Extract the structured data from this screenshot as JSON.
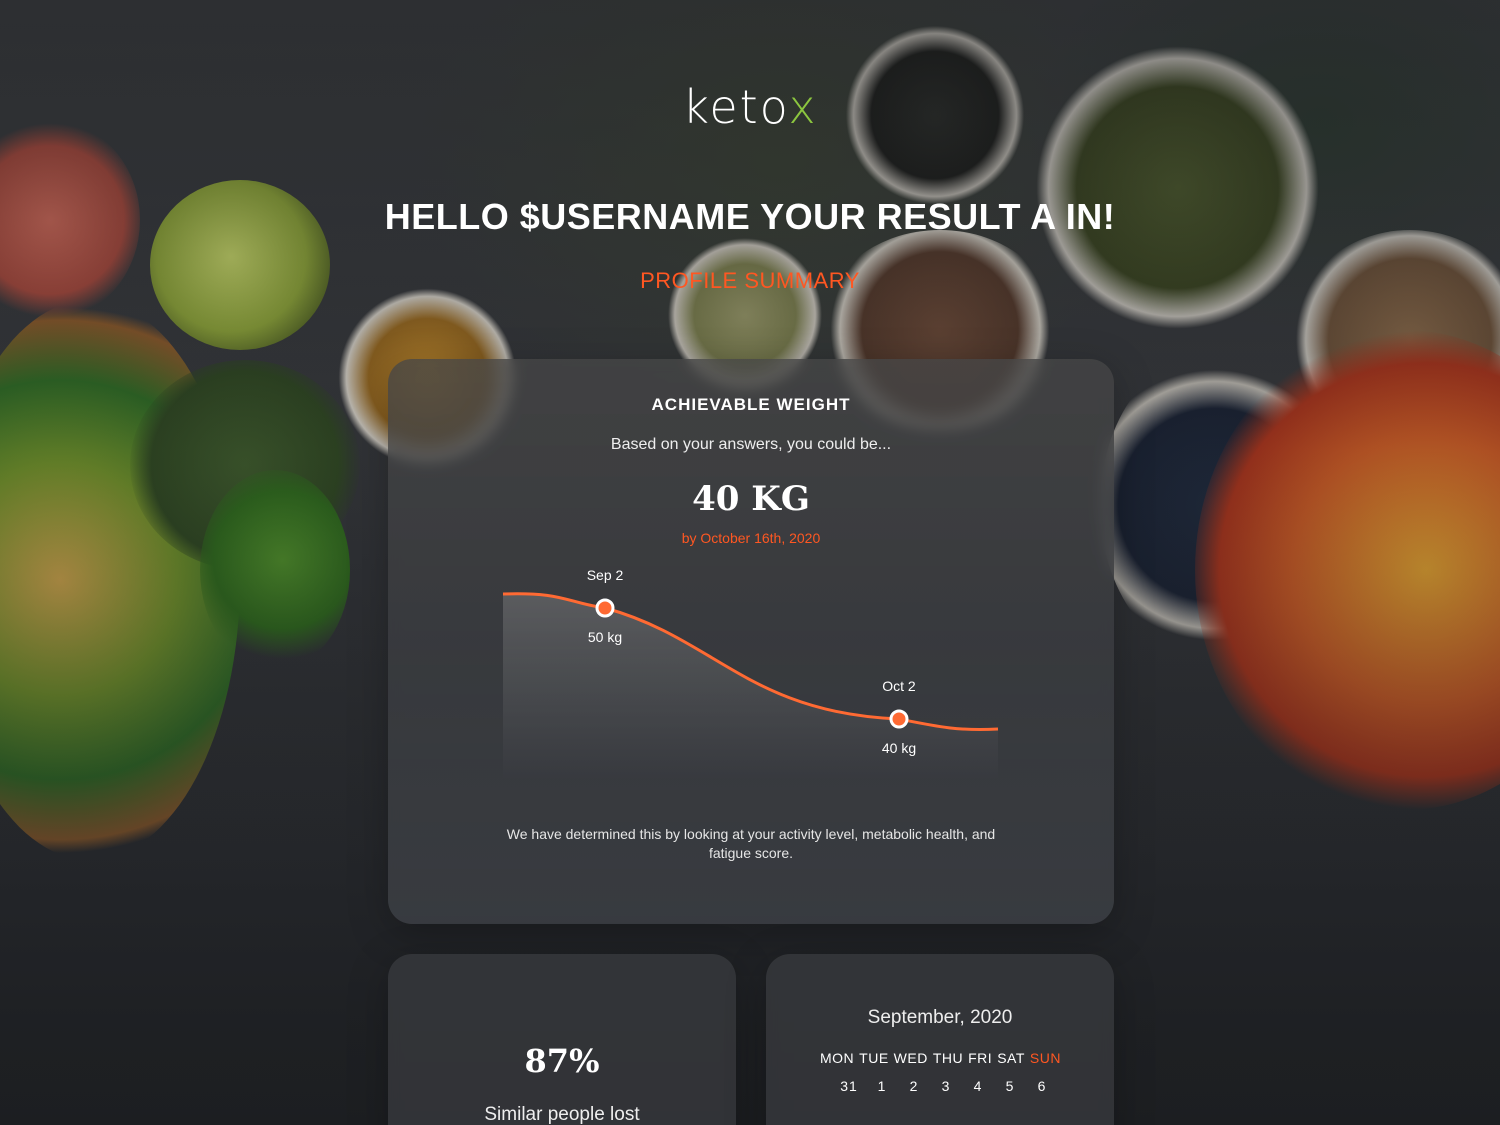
{
  "brand": {
    "name_prefix": "keto",
    "name_accent": "x",
    "accent_color": "#8cc63f"
  },
  "header": {
    "greeting": "HELLO $USERNAME YOUR RESULT A IN!",
    "section": "PROFILE SUMMARY",
    "section_color": "#ff5722"
  },
  "weight_card": {
    "title": "ACHIEVABLE WEIGHT",
    "subtitle": "Based on your answers, you could be...",
    "target": "40 KG",
    "target_date": "by October 16th, 2020",
    "footnote": "We have determined this by looking at your activity level, metabolic health, and fatigue score."
  },
  "chart_data": {
    "type": "line",
    "series": [
      {
        "points": [
          {
            "x": "Sep 2",
            "y": 50,
            "label": "50 kg"
          },
          {
            "x": "Oct 2",
            "y": 40,
            "label": "40 kg"
          }
        ]
      }
    ],
    "line_color": "#ff6a33",
    "grid": false
  },
  "stats_card": {
    "value": "87%",
    "label": "Similar people lost"
  },
  "calendar_card": {
    "month": "September, 2020",
    "weekdays": [
      "MON",
      "TUE",
      "WED",
      "THU",
      "FRI",
      "SAT",
      "SUN"
    ],
    "highlight_day": "SUN",
    "days": [
      "31",
      "1",
      "2",
      "3",
      "4",
      "5",
      "6"
    ]
  }
}
